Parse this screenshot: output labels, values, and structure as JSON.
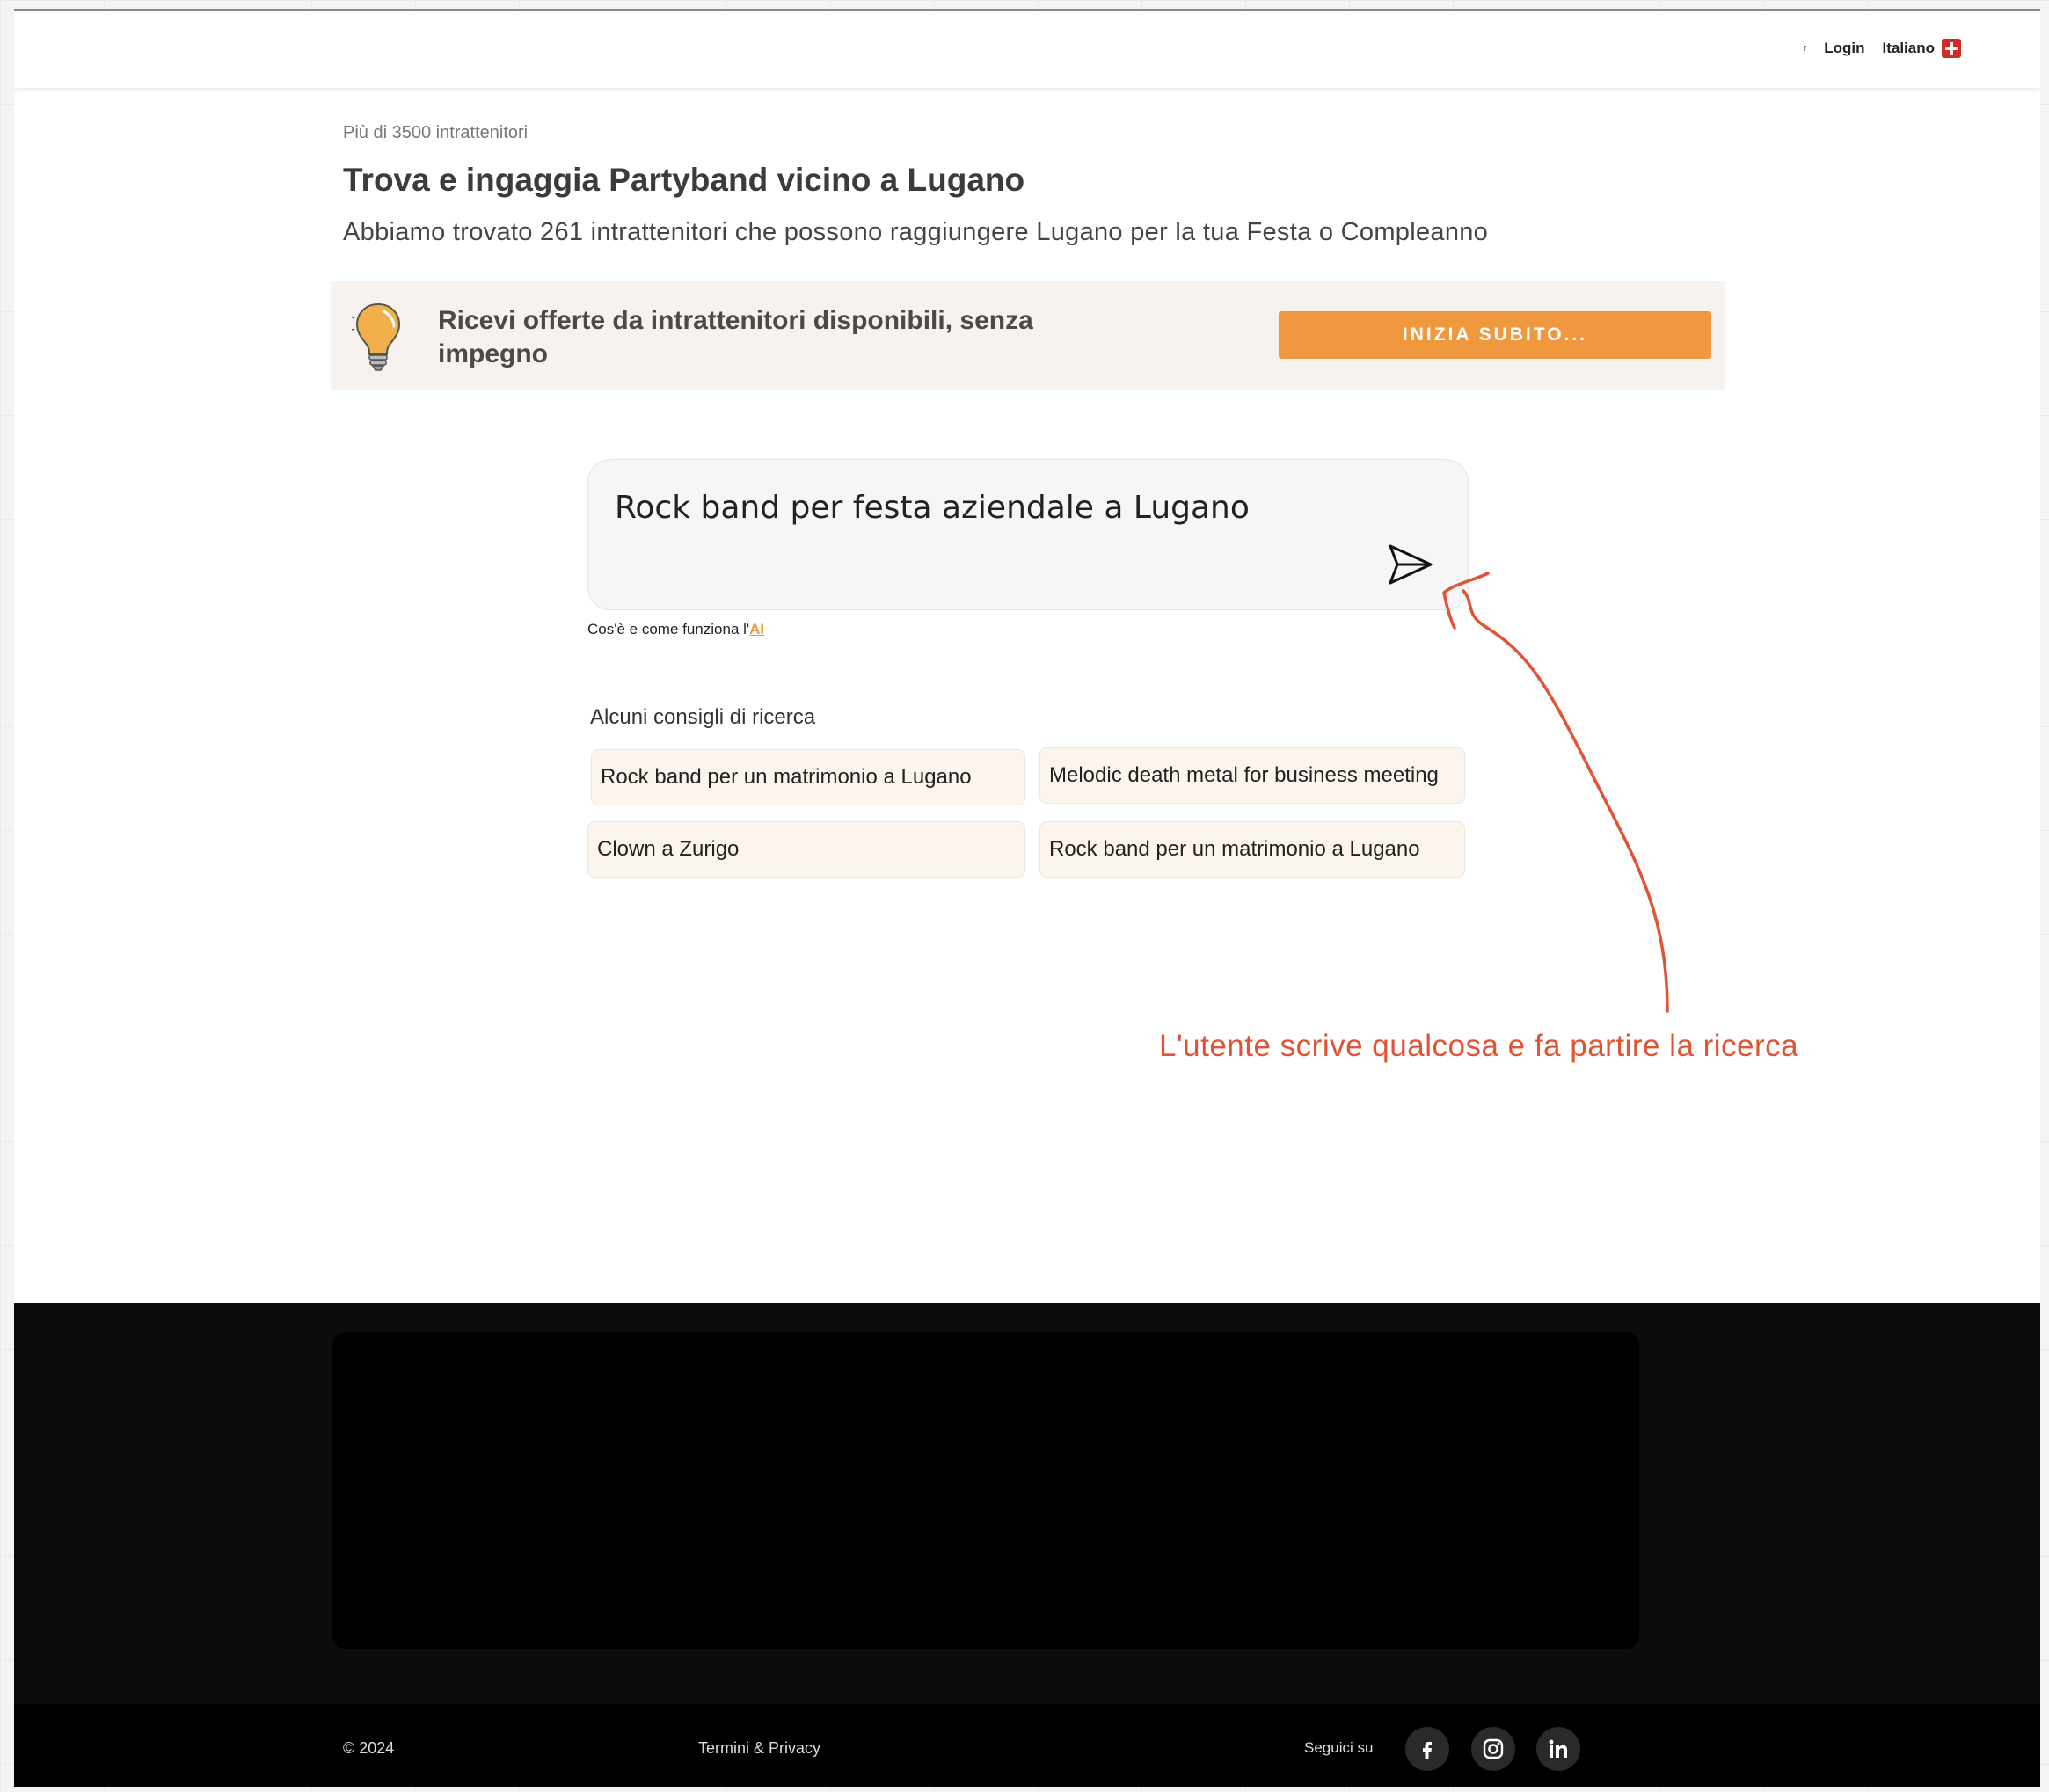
{
  "header": {
    "nav_mark": "r",
    "login_label": "Login",
    "language_label": "Italiano"
  },
  "hero": {
    "count_label": "Più di 3500 intrattenitori",
    "title": "Trova e ingaggia Partyband vicino a Lugano",
    "description": "Abbiamo trovato 261 intrattenitori che possono raggiungere Lugano per la tua Festa o Compleanno"
  },
  "offer_banner": {
    "icon": "lightbulb-icon",
    "text": "Ricevi offerte da intrattenitori disponibili, senza impegno",
    "button_label": "INIZIA SUBITO..."
  },
  "search": {
    "value": "Rock band per festa aziendale a Lugano",
    "send_icon": "send-icon",
    "help_prefix": "Cos'è e come funziona l'",
    "help_link": "AI"
  },
  "tips": {
    "title": "Alcuni consigli di ricerca",
    "items": [
      "Rock band per un matrimonio a Lugano",
      "Melodic death metal for business meeting",
      "Clown a Zurigo",
      "Rock band per un matrimonio a Lugano"
    ]
  },
  "annotation": {
    "text": "L'utente scrive qualcosa e fa partire la ricerca",
    "color": "#e05335"
  },
  "footer": {
    "copyright": "© 2024",
    "terms_label": "Termini & Privacy",
    "follow_label": "Seguici su",
    "social": [
      "facebook-icon",
      "instagram-icon",
      "linkedin-icon"
    ]
  },
  "colors": {
    "accent": "#f0983e",
    "banner_bg": "#f7f2ee",
    "tip_bg": "#fbf5ee",
    "footer_bg": "#0c0c0c"
  }
}
